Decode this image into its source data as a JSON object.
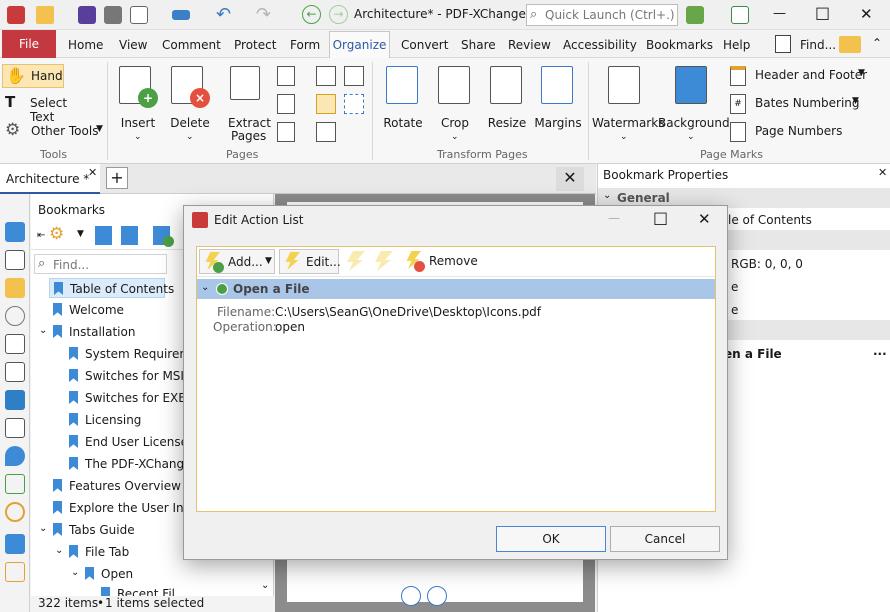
{
  "titlebar": {
    "title": "Architecture* - PDF-XChange E...",
    "quick_launch_placeholder": "Quick Launch (Ctrl+.)",
    "minimize": "—",
    "maximize": "□",
    "close": "✕"
  },
  "menu": {
    "file": "File",
    "items": [
      "Home",
      "View",
      "Comment",
      "Protect",
      "Form",
      "Organize",
      "Convert",
      "Share",
      "Review",
      "Accessibility",
      "Bookmarks",
      "Help"
    ],
    "find": "Find..."
  },
  "ribbon": {
    "tools": {
      "label": "Tools",
      "hand": "Hand",
      "select_text": "Select Text",
      "other_tools": "Other Tools"
    },
    "pages": {
      "label": "Pages",
      "insert": "Insert",
      "delete": "Delete",
      "extract": "Extract",
      "extract2": "Pages"
    },
    "transform": {
      "label": "Transform Pages",
      "rotate": "Rotate",
      "crop": "Crop",
      "resize": "Resize",
      "margins": "Margins"
    },
    "marks": {
      "label": "Page Marks",
      "watermarks": "Watermarks",
      "background": "Background",
      "header_footer": "Header and Footer",
      "bates": "Bates Numbering",
      "page_numbers": "Page Numbers"
    }
  },
  "doc_tab": {
    "label": "Architecture *"
  },
  "bookmarks": {
    "title": "Bookmarks",
    "find_placeholder": "Find...",
    "items": [
      "Table of Contents",
      "Welcome",
      "Installation",
      "System Requireme",
      "Switches for MSI In",
      "Switches for EXE In",
      "Licensing",
      "End User License A",
      "The PDF-XChange",
      "Features Overview",
      "Explore the User Inter",
      "Tabs Guide",
      "File Tab",
      "Open",
      "Recent Fil"
    ],
    "status_count": "322 items",
    "status_sep": "•",
    "status_selected": "1 items selected"
  },
  "properties": {
    "title": "Bookmark Properties",
    "general": "General",
    "rows": [
      "le of Contents",
      "RGB: 0, 0, 0",
      "e",
      "e",
      "en a File"
    ],
    "more": "..."
  },
  "dialog": {
    "title": "Edit Action List",
    "add": "Add...",
    "edit": "Edit...",
    "remove": "Remove",
    "action_name": "Open a File",
    "filename_label": "Filename:",
    "filename_value": "C:\\Users\\SeanG\\OneDrive\\Desktop\\Icons.pdf",
    "operation_label": "Operation:",
    "operation_value": "open",
    "ok": "OK",
    "cancel": "Cancel"
  }
}
